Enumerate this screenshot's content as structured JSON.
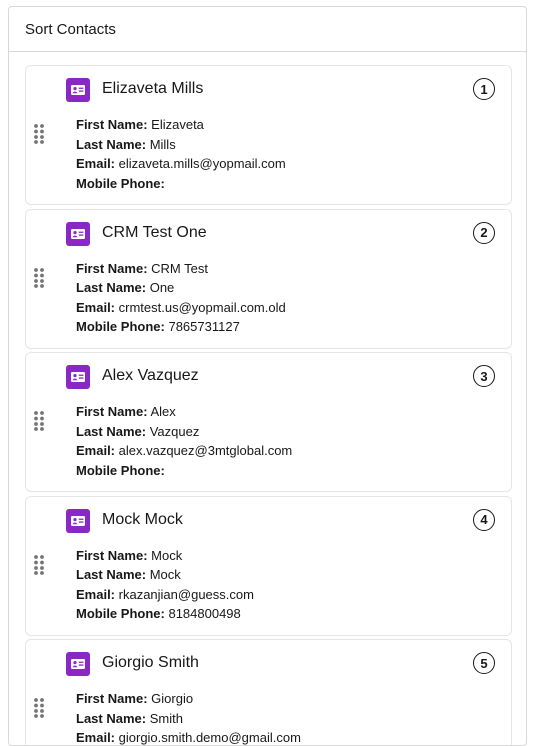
{
  "header": {
    "title": "Sort Contacts"
  },
  "labels": {
    "first_name": "First Name:",
    "last_name": "Last Name:",
    "email": "Email:",
    "mobile_phone": "Mobile Phone:"
  },
  "icons": {
    "card_icon": "contact-card-icon",
    "drag_icon": "drag-handle-icon",
    "accent_color": "#8a28c6"
  },
  "contacts": [
    {
      "order": "1",
      "name": "Elizaveta Mills",
      "first_name": "Elizaveta",
      "last_name": "Mills",
      "email": "elizaveta.mills@yopmail.com",
      "mobile_phone": ""
    },
    {
      "order": "2",
      "name": "CRM Test One",
      "first_name": "CRM Test",
      "last_name": "One",
      "email": "crmtest.us@yopmail.com.old",
      "mobile_phone": "7865731127"
    },
    {
      "order": "3",
      "name": "Alex Vazquez",
      "first_name": "Alex",
      "last_name": "Vazquez",
      "email": "alex.vazquez@3mtglobal.com",
      "mobile_phone": ""
    },
    {
      "order": "4",
      "name": "Mock Mock",
      "first_name": "Mock",
      "last_name": "Mock",
      "email": "rkazanjian@guess.com",
      "mobile_phone": "8184800498"
    },
    {
      "order": "5",
      "name": "Giorgio Smith",
      "first_name": "Giorgio",
      "last_name": "Smith",
      "email": "giorgio.smith.demo@gmail.com",
      "mobile_phone": ""
    }
  ]
}
